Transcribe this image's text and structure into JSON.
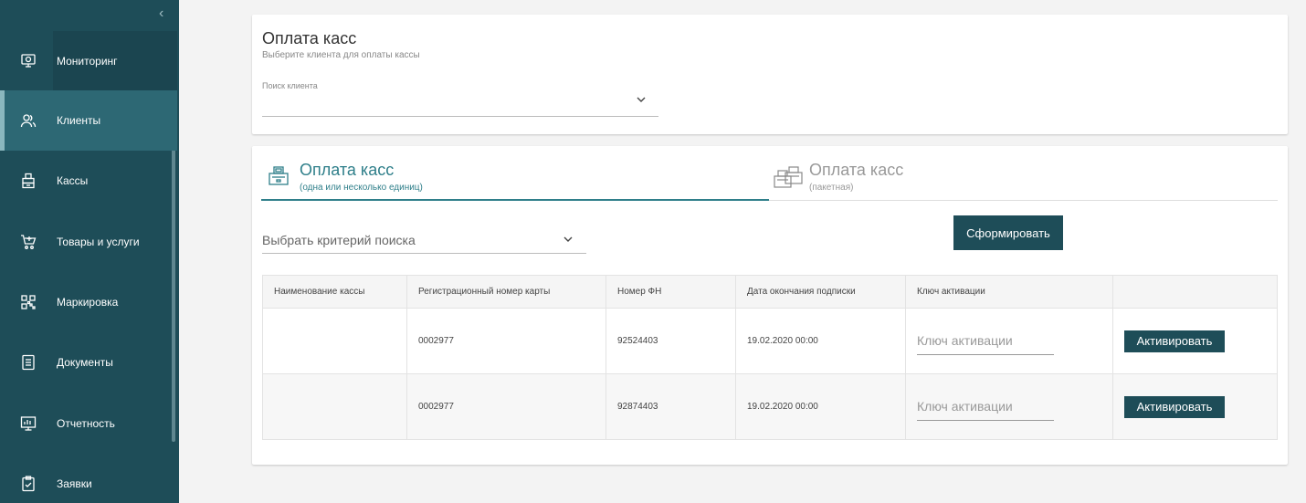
{
  "sidebar": {
    "items": [
      {
        "label": "Мониторинг",
        "icon": "monitor-icon"
      },
      {
        "label": "Клиенты",
        "icon": "users-icon"
      },
      {
        "label": "Кассы",
        "icon": "cash-register-icon"
      },
      {
        "label": "Товары и услуги",
        "icon": "cart-icon"
      },
      {
        "label": "Маркировка",
        "icon": "qr-code-icon"
      },
      {
        "label": "Документы",
        "icon": "document-icon"
      },
      {
        "label": "Отчетность",
        "icon": "report-icon"
      },
      {
        "label": "Заявки",
        "icon": "clipboard-check-icon"
      }
    ]
  },
  "header": {
    "title": "Оплата касс",
    "subtitle": "Выберите клиента для оплаты кассы",
    "search_label": "Поиск клиента",
    "search_value": ""
  },
  "tabs": [
    {
      "title": "Оплата касс",
      "subtitle": "(одна или несколько единиц)",
      "active": true
    },
    {
      "title": "Оплата касс",
      "subtitle": "(пакетная)",
      "active": false
    }
  ],
  "criteria": {
    "placeholder": "Выбрать критерий поиска"
  },
  "form_button": "Сформировать",
  "table": {
    "columns": [
      "Наименование кассы",
      "Регистрационный номер карты",
      "Номер ФН",
      "Дата окончания подписки",
      "Ключ активации",
      ""
    ],
    "rows": [
      {
        "name": "",
        "reg_number": "0002977",
        "fn_number": "92524403",
        "subscription_end": "19.02.2020 00:00",
        "key_placeholder": "Ключ активации",
        "action": "Активировать"
      },
      {
        "name": "",
        "reg_number": "0002977",
        "fn_number": "92874403",
        "subscription_end": "19.02.2020 00:00",
        "key_placeholder": "Ключ активации",
        "action": "Активировать"
      }
    ]
  },
  "colors": {
    "sidebar": "#1e4d58",
    "sidebar_active": "#2d6874",
    "accent": "#2f7f8a",
    "button": "#1e4d58"
  }
}
